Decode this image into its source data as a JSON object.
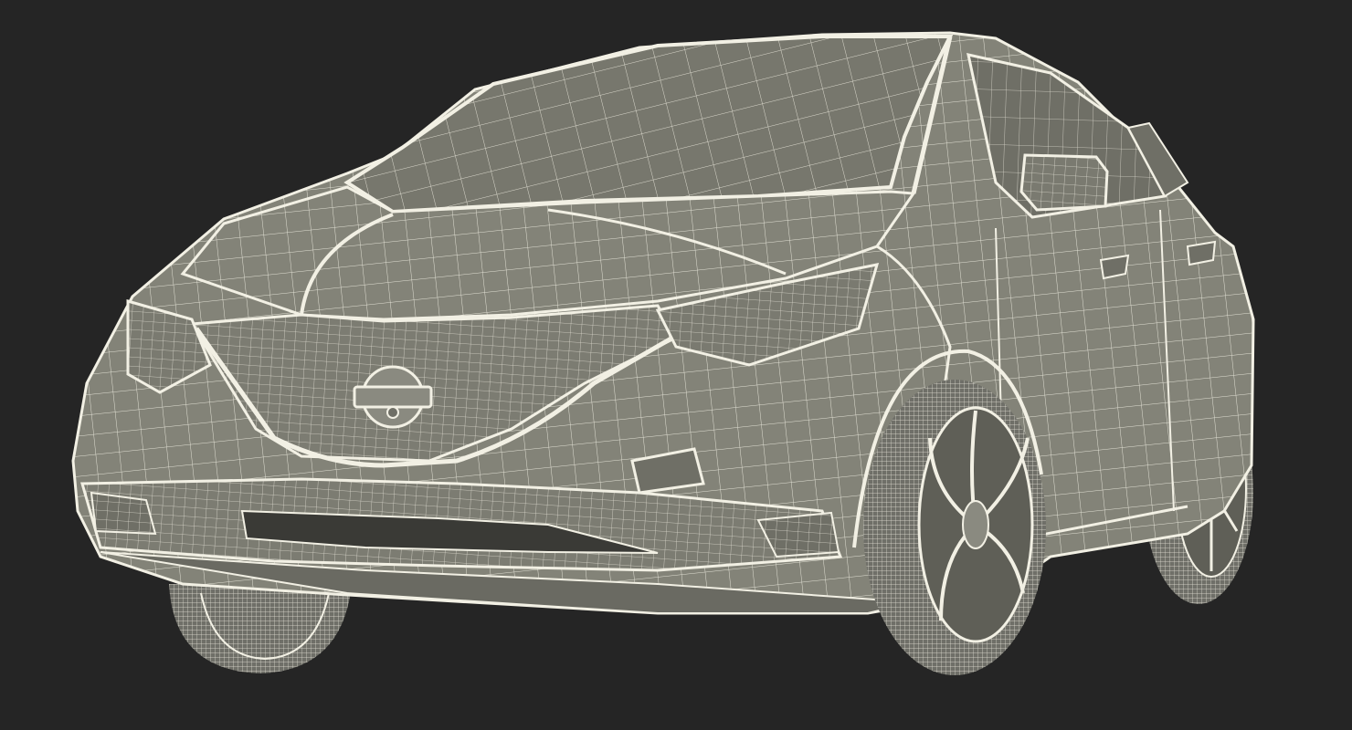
{
  "scene": {
    "subject": "car-wireframe-render",
    "view": "front-three-quarter",
    "colors": {
      "background": "#252525",
      "body_shade": "#838378",
      "body_shade_dark": "#5f5f57",
      "glass_shade": "#77776d",
      "wire": "#f2f0e4",
      "tire": "#6f6f68"
    }
  }
}
